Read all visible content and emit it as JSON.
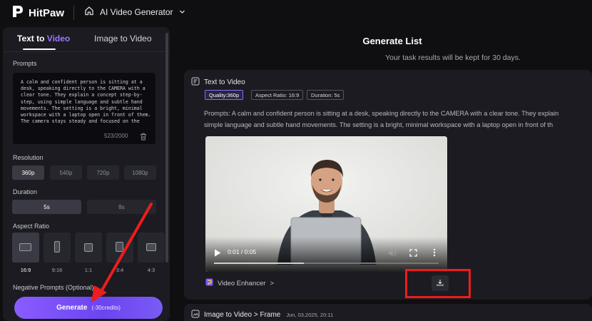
{
  "app": {
    "brand": "HitPaw",
    "product": "AI Video Generator"
  },
  "left_panel": {
    "tabs": [
      {
        "label_prefix": "Text to ",
        "label_accent": "Video",
        "active": true
      },
      {
        "label": "Image to Video",
        "active": false
      }
    ],
    "prompts_label": "Prompts",
    "prompt_text": "A calm and confident person is sitting at a desk, speaking directly to the CAMERA with a clear tone. They explain a concept step-by-step, using simple language and subtle hand movements. The setting is a bright, minimal workspace with a laptop open in front of them. The camera stays steady and focused on the",
    "prompt_counter": "523/2000",
    "resolution_label": "Resolution",
    "resolutions": [
      "360p",
      "540p",
      "720p",
      "1080p"
    ],
    "resolution_selected": "360p",
    "duration_label": "Duration",
    "durations": [
      "5s",
      "8s"
    ],
    "duration_selected": "5s",
    "aspect_label": "Aspect Ratio",
    "aspect_ratios": [
      "16:9",
      "9:16",
      "1:1",
      "3:4",
      "4:3"
    ],
    "aspect_selected": "16:9",
    "negative_label": "Negative Prompts (Optional)",
    "generate_label": "Generate",
    "generate_credits": "(-30credits)"
  },
  "main": {
    "title": "Generate List",
    "subtitle": "Your task results will be kept for 30 days.",
    "task1": {
      "type": "Text to Video",
      "chips": [
        "Quality:360p",
        "Aspect Ratio: 16:9",
        "Duration: 5s"
      ],
      "prompt_line1": "Prompts:  A calm and confident person is sitting at a desk, speaking directly to the CAMERA with a clear tone. They explain",
      "prompt_line2": "simple language and subtle hand movements. The setting is a bright, minimal workspace with a laptop open in front of th",
      "video_time": "0:01 / 0:05",
      "video_progress": 0.4,
      "enhancer_label": "Video Enhancer",
      "enhancer_chevron": ">"
    },
    "task2": {
      "type": "Image to Video > Frame",
      "date": "Jun, 03,2025, 20:11"
    }
  },
  "colors": {
    "accent": "#8a5cff",
    "highlight": "#ee1c1c"
  },
  "icons": {
    "logo": "hitpaw-logo-icon",
    "home": "home-icon",
    "dropdown": "chevron-down-icon",
    "trash": "trash-icon",
    "task": "task-icon",
    "play": "play-icon",
    "volume": "volume-icon",
    "fullscreen": "fullscreen-icon",
    "more": "more-vertical-icon",
    "enhancer": "enhancer-icon",
    "download": "download-icon"
  }
}
